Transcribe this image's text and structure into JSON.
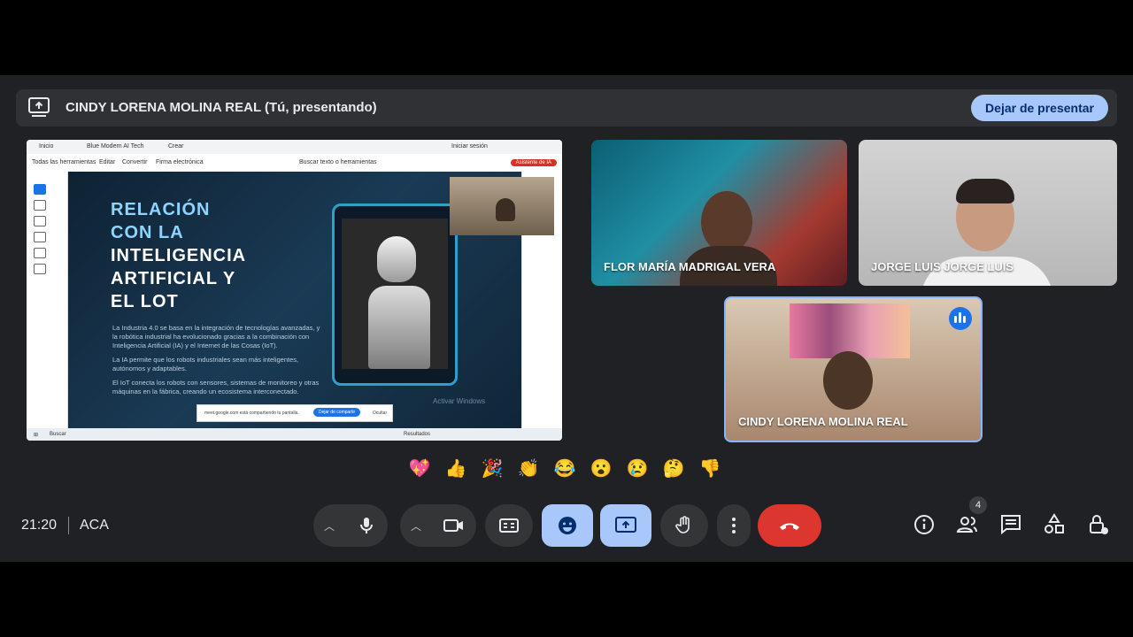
{
  "banner": {
    "presenter_text": "CINDY LORENA MOLINA REAL (Tú, presentando)",
    "stop_label": "Dejar de presentar"
  },
  "shared_screen": {
    "browser_tabs": [
      "Inicio",
      "Blue Modern AI Tech",
      "Crear"
    ],
    "sign_in": "Iniciar sesión",
    "menu": [
      "Todas las herramientas",
      "Editar",
      "Convertir",
      "Firma electrónica"
    ],
    "search_placeholder": "Buscar texto o herramientas",
    "ai_button": "Asistente de IA",
    "slide": {
      "title_line1": "RELACIÓN",
      "title_line2": "CON LA",
      "title_line3": "INTELIGENCIA",
      "title_line4": "ARTIFICIAL Y",
      "title_line5": "EL LOT",
      "para1": "La Industria 4.0 se basa en la integración de tecnologías avanzadas, y la robótica industrial ha evolucionado gracias a la combinación con Inteligencia Artificial (IA) y el Internet de las Cosas (IoT).",
      "para2": "La IA permite que los robots industriales sean más inteligentes, autónomos y adaptables.",
      "para3": "El IoT conecta los robots con sensores, sistemas de monitoreo y otras máquinas en la fábrica, creando un ecosistema interconectado.",
      "watermark": "Activar Windows"
    },
    "share_notice": {
      "text": "meet.google.com está compartiendo tu pantalla.",
      "stop": "Dejar de compartir",
      "hide": "Ocultar"
    },
    "taskbar": {
      "search": "Buscar",
      "result": "Resultados"
    }
  },
  "participants": [
    {
      "name": "FLOR MARÍA MADRIGAL VERA"
    },
    {
      "name": "JORGE LUIS JORGE LUIS"
    },
    {
      "name": "CINDY LORENA MOLINA REAL"
    }
  ],
  "reactions": [
    "💖",
    "👍",
    "🎉",
    "👏",
    "😂",
    "😮",
    "😢",
    "🤔",
    "👎"
  ],
  "footer": {
    "time": "21:20",
    "meeting_code": "ACA",
    "people_count": "4"
  },
  "colors": {
    "accent": "#a8c7fa",
    "hangup": "#dc362e",
    "background": "#202124"
  }
}
